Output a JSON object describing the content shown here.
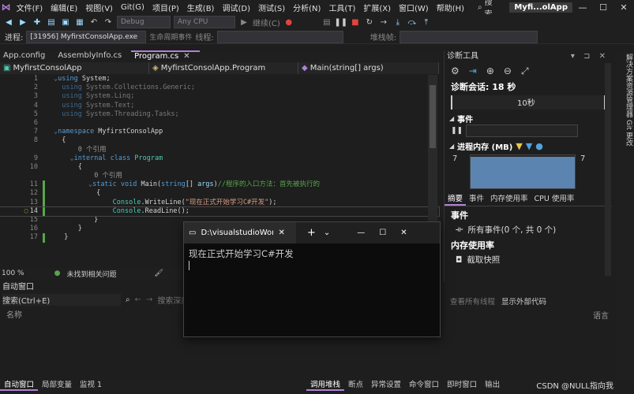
{
  "menu": {
    "items": [
      "文件(F)",
      "编辑(E)",
      "视图(V)",
      "Git(G)",
      "项目(P)",
      "生成(B)",
      "调试(D)",
      "测试(S)",
      "分析(N)",
      "工具(T)",
      "扩展(X)",
      "窗口(W)",
      "帮助(H)"
    ],
    "search_label": "搜索",
    "app_title": "Myfi...olApp"
  },
  "toolbar": {
    "config": "Debug",
    "platform": "Any CPU",
    "continue_label": "继续(C)"
  },
  "toolbar2": {
    "process_label": "进程:",
    "process_value": "[31956] MyfirstConsolApp.exe",
    "lifecycle_label": "生命周期事件",
    "thread_label": "线程:",
    "stackframe_label": "堆栈帧:"
  },
  "tabs": [
    {
      "label": "App.config"
    },
    {
      "label": "AssemblyInfo.cs"
    },
    {
      "label": "Program.cs"
    }
  ],
  "navbar": {
    "project": "MyfirstConsolApp",
    "class": "MyfirstConsolApp.Program",
    "method": "Main(string[] args)"
  },
  "code": {
    "line_numbers": [
      "1",
      "2",
      "3",
      "4",
      "5",
      "6",
      "7",
      "8",
      "",
      "9",
      "10",
      "",
      "11",
      "12",
      "13",
      "14",
      "15",
      "16",
      "17"
    ],
    "ref_0": "0 个引用",
    "ref_1": "0 个引用"
  },
  "zoombar": {
    "zoom": "100 %",
    "status": "未找到相关问题"
  },
  "auto_window": {
    "title": "自动窗口",
    "search_placeholder": "搜索(Ctrl+E)",
    "search_depth_label": "搜索深度",
    "col_name": "名称",
    "col_lang": "语言",
    "view_all_threads": "查看所有线程",
    "show_external_code": "显示外部代码"
  },
  "bottom_tabs_left": [
    "自动窗口",
    "局部变量",
    "监视 1"
  ],
  "bottom_tabs_right": [
    "调用堆栈",
    "断点",
    "异常设置",
    "命令窗口",
    "即时窗口",
    "输出"
  ],
  "diag": {
    "title": "诊断工具",
    "session_label": "诊断会话: 18 秒",
    "timeline_label": "10秒",
    "events_head": "事件",
    "memory_head": "进程内存 (MB)",
    "mem_left": "7",
    "mem_right": "7",
    "mem_bar_fraction": 0.95,
    "tabs": [
      "摘要",
      "事件",
      "内存使用率",
      "CPU 使用率"
    ],
    "events_section": "事件",
    "all_events": "所有事件(0 个, 共 0 个)",
    "mem_usage_section": "内存使用率",
    "snapshot_label": "截取快照"
  },
  "vert_rail": {
    "text": "解决方案资源管理器  Git 更改"
  },
  "console": {
    "tab_title": "D:\\visualstudioWor",
    "output": "现在正式开始学习C#开发"
  },
  "watermark": "CSDN @NULL指向我",
  "colors": {
    "accent": "#b180d7",
    "keyword": "#569cd6",
    "type": "#4ec9b0",
    "string": "#d69d85",
    "comment": "#57a64a"
  }
}
